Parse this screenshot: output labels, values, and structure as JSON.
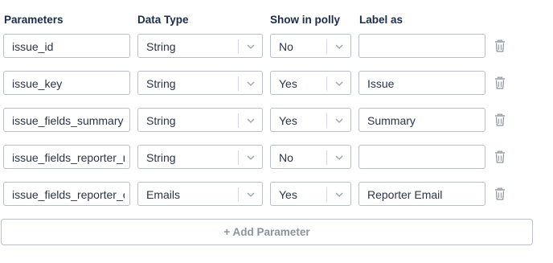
{
  "headers": {
    "parameters": "Parameters",
    "data_type": "Data Type",
    "show_in_polly": "Show in polly",
    "label_as": "Label as"
  },
  "rows": [
    {
      "parameter": "issue_id",
      "data_type": "String",
      "show": "No",
      "label": ""
    },
    {
      "parameter": "issue_key",
      "data_type": "String",
      "show": "Yes",
      "label": "Issue"
    },
    {
      "parameter": "issue_fields_summary",
      "data_type": "String",
      "show": "Yes",
      "label": "Summary"
    },
    {
      "parameter": "issue_fields_reporter_n",
      "data_type": "String",
      "show": "No",
      "label": ""
    },
    {
      "parameter": "issue_fields_reporter_e",
      "data_type": "Emails",
      "show": "Yes",
      "label": "Reporter Email"
    }
  ],
  "icons": {
    "dropdown": "chevron-down-icon",
    "delete": "trash-icon"
  },
  "add_button": {
    "label": "+ Add Parameter"
  },
  "colors": {
    "header_text": "#1a2b4b",
    "border": "#b9bec7",
    "muted": "#8c929c"
  }
}
